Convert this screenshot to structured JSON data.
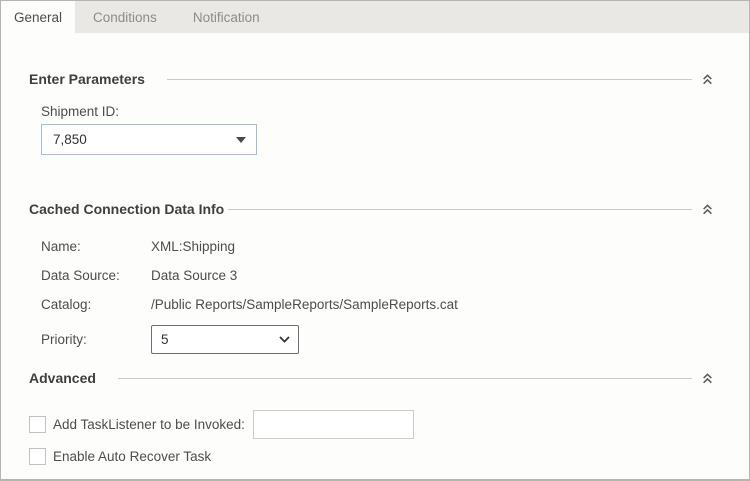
{
  "tabs": [
    {
      "label": "General",
      "active": true
    },
    {
      "label": "Conditions",
      "active": false
    },
    {
      "label": "Notification",
      "active": false
    }
  ],
  "sections": {
    "parameters": {
      "title": "Enter Parameters",
      "shipment_label": "Shipment ID:",
      "shipment_value": "7,850"
    },
    "cached": {
      "title": "Cached Connection Data Info",
      "rows": [
        {
          "label": "Name:",
          "value": "XML:Shipping"
        },
        {
          "label": "Data Source:",
          "value": "Data Source 3"
        },
        {
          "label": "Catalog:",
          "value": "/Public Reports/SampleReports/SampleReports.cat"
        }
      ],
      "priority_label": "Priority:",
      "priority_value": "5"
    },
    "advanced": {
      "title": "Advanced",
      "tasklistener_label": "Add TaskListener to be Invoked:",
      "tasklistener_value": "",
      "tasklistener_checked": false,
      "autorecover_label": "Enable Auto Recover Task",
      "autorecover_checked": false
    }
  },
  "icons": {
    "collapse": "chevron-double-up",
    "combo_arrow": "triangle-down",
    "select_arrow": "chevron-down"
  },
  "colors": {
    "tabbar_bg": "#e9e8e4",
    "content_bg": "#fdfdfb",
    "window_border": "#b4b4b0",
    "combo_border_accent": "#a3bfdc",
    "divider": "#c9c9c9",
    "text_dark": "#3f3f3f",
    "text_body": "#4d4d4d",
    "text_inactive_tab": "#8c8c8c"
  }
}
